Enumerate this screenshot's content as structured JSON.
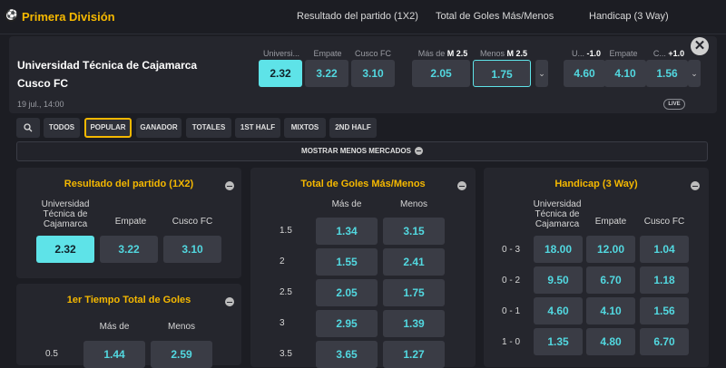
{
  "header": {
    "league": "Primera División",
    "markets": [
      "Resultado del partido (1X2)",
      "Total de Goles Más/Menos",
      "Handicap (3 Way)"
    ]
  },
  "event": {
    "home": "Universidad Técnica de Cajamarca",
    "away": "Cusco FC",
    "time": "19 jul.,   14:00",
    "live_badge": "LIVE",
    "m1": {
      "labels": [
        "Universi...",
        "Empate",
        "Cusco FC"
      ],
      "odds": [
        "2.32",
        "3.22",
        "3.10"
      ]
    },
    "m2": {
      "labels": [
        "Más de",
        "Menos"
      ],
      "lines": [
        "M 2.5",
        "M 2.5"
      ],
      "odds": [
        "2.05",
        "1.75"
      ]
    },
    "m3": {
      "labels": [
        "U...",
        "Empate",
        "C..."
      ],
      "lines": [
        "-1.0",
        "+1.0"
      ],
      "odds": [
        "4.60",
        "4.10",
        "1.56"
      ]
    }
  },
  "tabs": [
    "TODOS",
    "POPULAR",
    "GANADOR",
    "TOTALES",
    "1ST HALF",
    "MIXTOS",
    "2ND HALF"
  ],
  "show_less": "MOSTRAR MENOS MERCADOS",
  "panels": {
    "result": {
      "title": "Resultado del partido (1X2)",
      "cols": [
        "Universidad\nTécnica de\nCajamarca",
        "Empate",
        "Cusco FC"
      ],
      "odds": [
        "2.32",
        "3.22",
        "3.10"
      ]
    },
    "half": {
      "title": "1er Tiempo Total de Goles",
      "cols": [
        "Más de",
        "Menos"
      ],
      "rows": [
        {
          "line": "0.5",
          "odds": [
            "1.44",
            "2.59"
          ]
        }
      ]
    },
    "totals": {
      "title": "Total de Goles Más/Menos",
      "cols": [
        "Más de",
        "Menos"
      ],
      "rows": [
        {
          "line": "1.5",
          "odds": [
            "1.34",
            "3.15"
          ]
        },
        {
          "line": "2",
          "odds": [
            "1.55",
            "2.41"
          ]
        },
        {
          "line": "2.5",
          "odds": [
            "2.05",
            "1.75"
          ]
        },
        {
          "line": "3",
          "odds": [
            "2.95",
            "1.39"
          ]
        },
        {
          "line": "3.5",
          "odds": [
            "3.65",
            "1.27"
          ]
        }
      ]
    },
    "handicap": {
      "title": "Handicap (3 Way)",
      "cols": [
        "Universidad\nTécnica de\nCajamarca",
        "Empate",
        "Cusco FC"
      ],
      "rows": [
        {
          "line": "0 - 3",
          "odds": [
            "18.00",
            "12.00",
            "1.04"
          ]
        },
        {
          "line": "0 - 2",
          "odds": [
            "9.50",
            "6.70",
            "1.18"
          ]
        },
        {
          "line": "0 - 1",
          "odds": [
            "4.60",
            "4.10",
            "1.56"
          ]
        },
        {
          "line": "1 - 0",
          "odds": [
            "1.35",
            "4.80",
            "6.70"
          ]
        }
      ]
    }
  },
  "colors": {
    "accent": "#f5b800",
    "odds": "#52d8e0",
    "selected": "#5ee3e8"
  }
}
